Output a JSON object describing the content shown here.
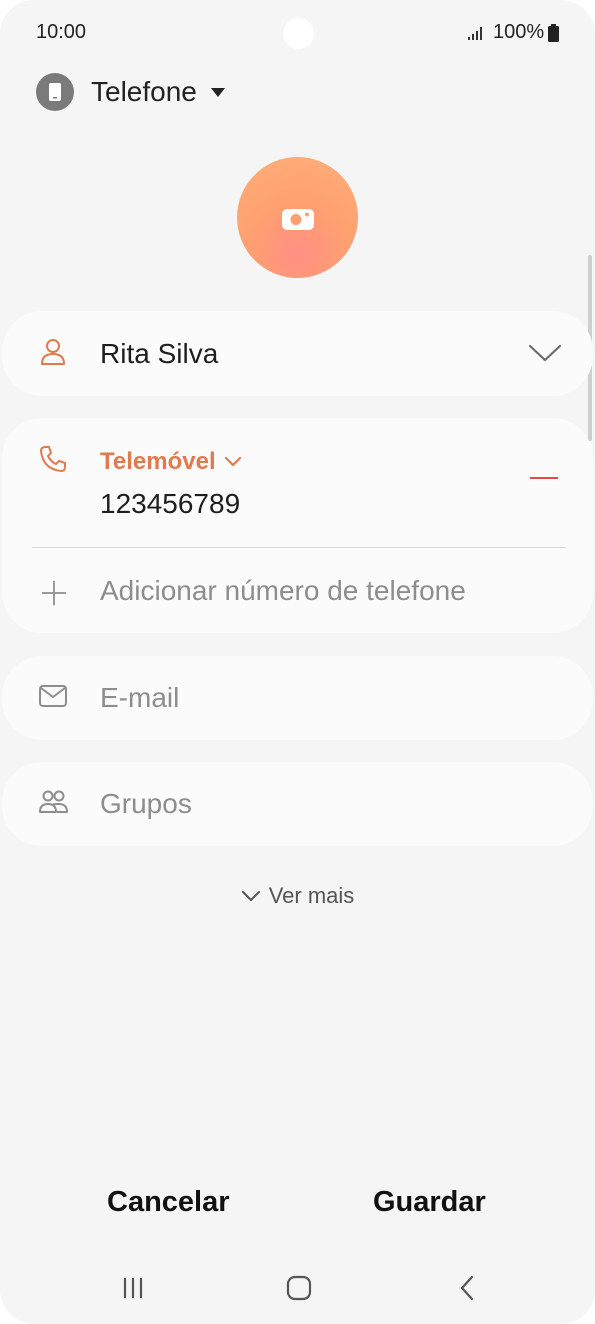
{
  "status_bar": {
    "time": "10:00",
    "battery": "100%",
    "icons": [
      "signal-icon",
      "battery-icon"
    ]
  },
  "account": {
    "label": "Telefone",
    "icon": "phone-device-icon"
  },
  "photo": {
    "icon": "camera-icon",
    "accent_color": "#ffa070"
  },
  "name_field": {
    "value": "Rita Silva",
    "icon": "person-icon",
    "expand_icon": "chevron-down-icon"
  },
  "phone_field": {
    "type_label": "Telemóvel",
    "number": "123456789",
    "add_placeholder": "Adicionar número de telefone",
    "icon": "phone-icon",
    "remove_icon": "minus-icon"
  },
  "email_field": {
    "placeholder": "E-mail",
    "icon": "mail-icon"
  },
  "groups_field": {
    "placeholder": "Grupos",
    "icon": "groups-icon"
  },
  "see_more": {
    "label": "Ver mais"
  },
  "actions": {
    "cancel": "Cancelar",
    "save": "Guardar"
  },
  "nav_bar": {
    "items": [
      "recents-icon",
      "home-icon",
      "back-icon"
    ]
  },
  "colors": {
    "accent": "#e07a4f",
    "remove": "#e34a46",
    "background": "#f5f5f5",
    "card": "#fbfbfb"
  }
}
